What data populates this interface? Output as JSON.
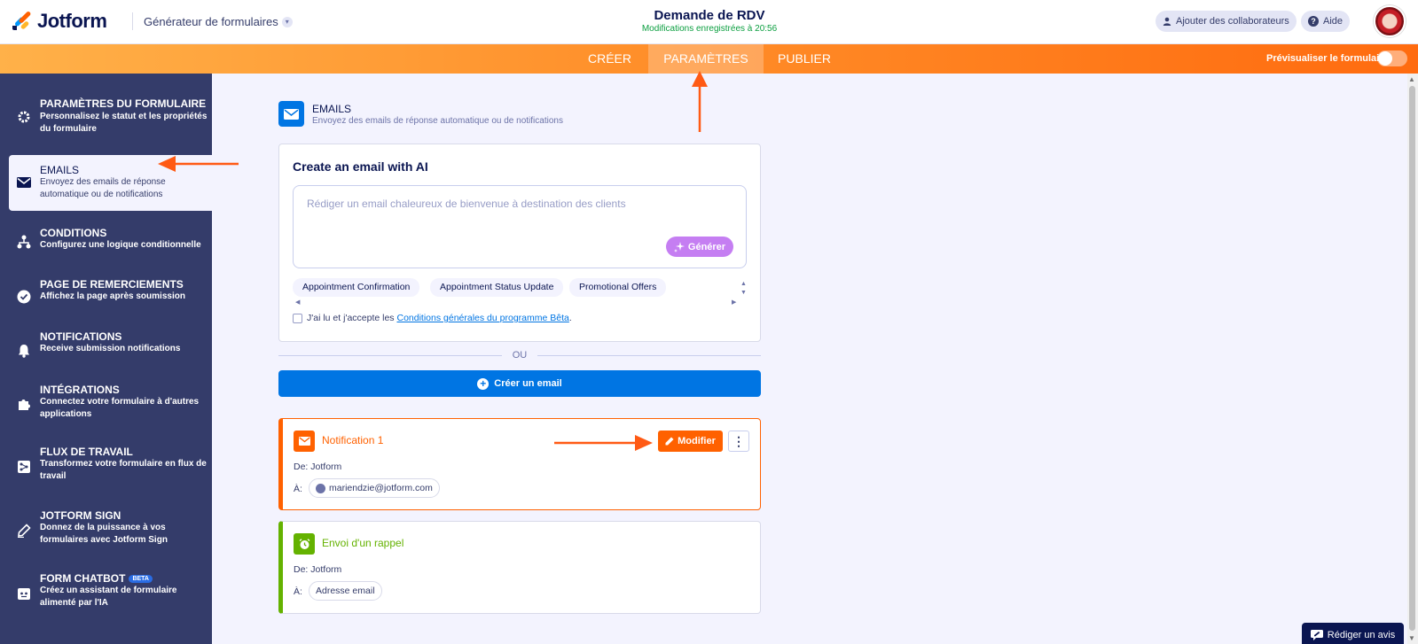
{
  "app": {
    "brand": "Jotform",
    "builder_label": "Générateur de formulaires",
    "form_title": "Demande de RDV",
    "saved_status": "Modifications enregistrées à 20:56",
    "collab_label": "Ajouter des collaborateurs",
    "help_label": "Aide",
    "accent_color": "#ff6100",
    "link_color": "#0075e3"
  },
  "nav": {
    "tabs": [
      {
        "label": "CRÉER",
        "active": false
      },
      {
        "label": "PARAMÈTRES",
        "active": true
      },
      {
        "label": "PUBLIER",
        "active": false
      }
    ],
    "preview_label": "Prévisualiser le formulaire",
    "preview_enabled": false
  },
  "sidebar": {
    "items": [
      {
        "title": "PARAMÈTRES DU FORMULAIRE",
        "desc": "Personnalisez le statut et les propriétés du formulaire",
        "icon": "gear-icon"
      },
      {
        "title": "EMAILS",
        "desc": "Envoyez des emails de réponse automatique ou de notifications",
        "icon": "envelope-icon",
        "active": true
      },
      {
        "title": "CONDITIONS",
        "desc": "Configurez une logique conditionnelle",
        "icon": "hierarchy-icon"
      },
      {
        "title": "PAGE DE REMERCIEMENTS",
        "desc": "Affichez la page après soumission",
        "icon": "check-circle-icon"
      },
      {
        "title": "NOTIFICATIONS",
        "desc": "Receive submission notifications",
        "icon": "bell-icon"
      },
      {
        "title": "INTÉGRATIONS",
        "desc": "Connectez votre formulaire à d'autres applications",
        "icon": "puzzle-icon"
      },
      {
        "title": "FLUX DE TRAVAIL",
        "desc": "Transformez votre formulaire en flux de travail",
        "icon": "workflow-icon"
      },
      {
        "title": "JOTFORM SIGN",
        "desc": "Donnez de la puissance à vos formulaires avec Jotform Sign",
        "icon": "pen-icon"
      },
      {
        "title": "FORM CHATBOT",
        "desc": "Créez un assistant de formulaire alimenté par l'IA",
        "icon": "chatbot-icon",
        "badge": "BETA"
      }
    ]
  },
  "section": {
    "title": "EMAILS",
    "subtitle": "Envoyez des emails de réponse automatique ou de notifications"
  },
  "ai": {
    "title": "Create an email with AI",
    "placeholder": "Rédiger un email chaleureux de bienvenue à destination des clients",
    "value": "",
    "generate_label": "Générer",
    "chips": [
      "Appointment Confirmation",
      "Appointment Status Update",
      "Promotional Offers"
    ],
    "terms_prefix": "J'ai lu et j'accepte les ",
    "terms_link": "Conditions générales du programme Bêta",
    "terms_suffix": ".",
    "terms_checked": false
  },
  "or_label": "OU",
  "create_label": "Créer un email",
  "emails": [
    {
      "title": "Notification 1",
      "from_label": "De:",
      "from": "Jotform",
      "to_label": "À:",
      "to": "mariendzie@jotform.com",
      "color": "#ff6100",
      "icon": "envelope-icon",
      "edit_label": "Modifier"
    },
    {
      "title": "Envoi d'un rappel",
      "from_label": "De:",
      "from": "Jotform",
      "to_label": "À:",
      "to": "Adresse email",
      "color": "#64b200",
      "icon": "alarm-icon"
    }
  ],
  "review_label": "Rédiger un avis"
}
